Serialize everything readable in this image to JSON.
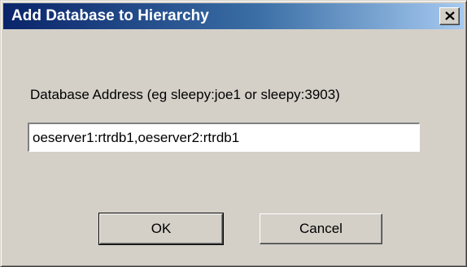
{
  "window": {
    "title": "Add Database to Hierarchy",
    "close_icon": "close-icon"
  },
  "form": {
    "address_label": "Database Address (eg sleepy:joe1 or sleepy:3903)",
    "address_value": "oeserver1:rtrdb1,oeserver2:rtrdb1"
  },
  "buttons": {
    "ok_label": "OK",
    "cancel_label": "Cancel"
  }
}
